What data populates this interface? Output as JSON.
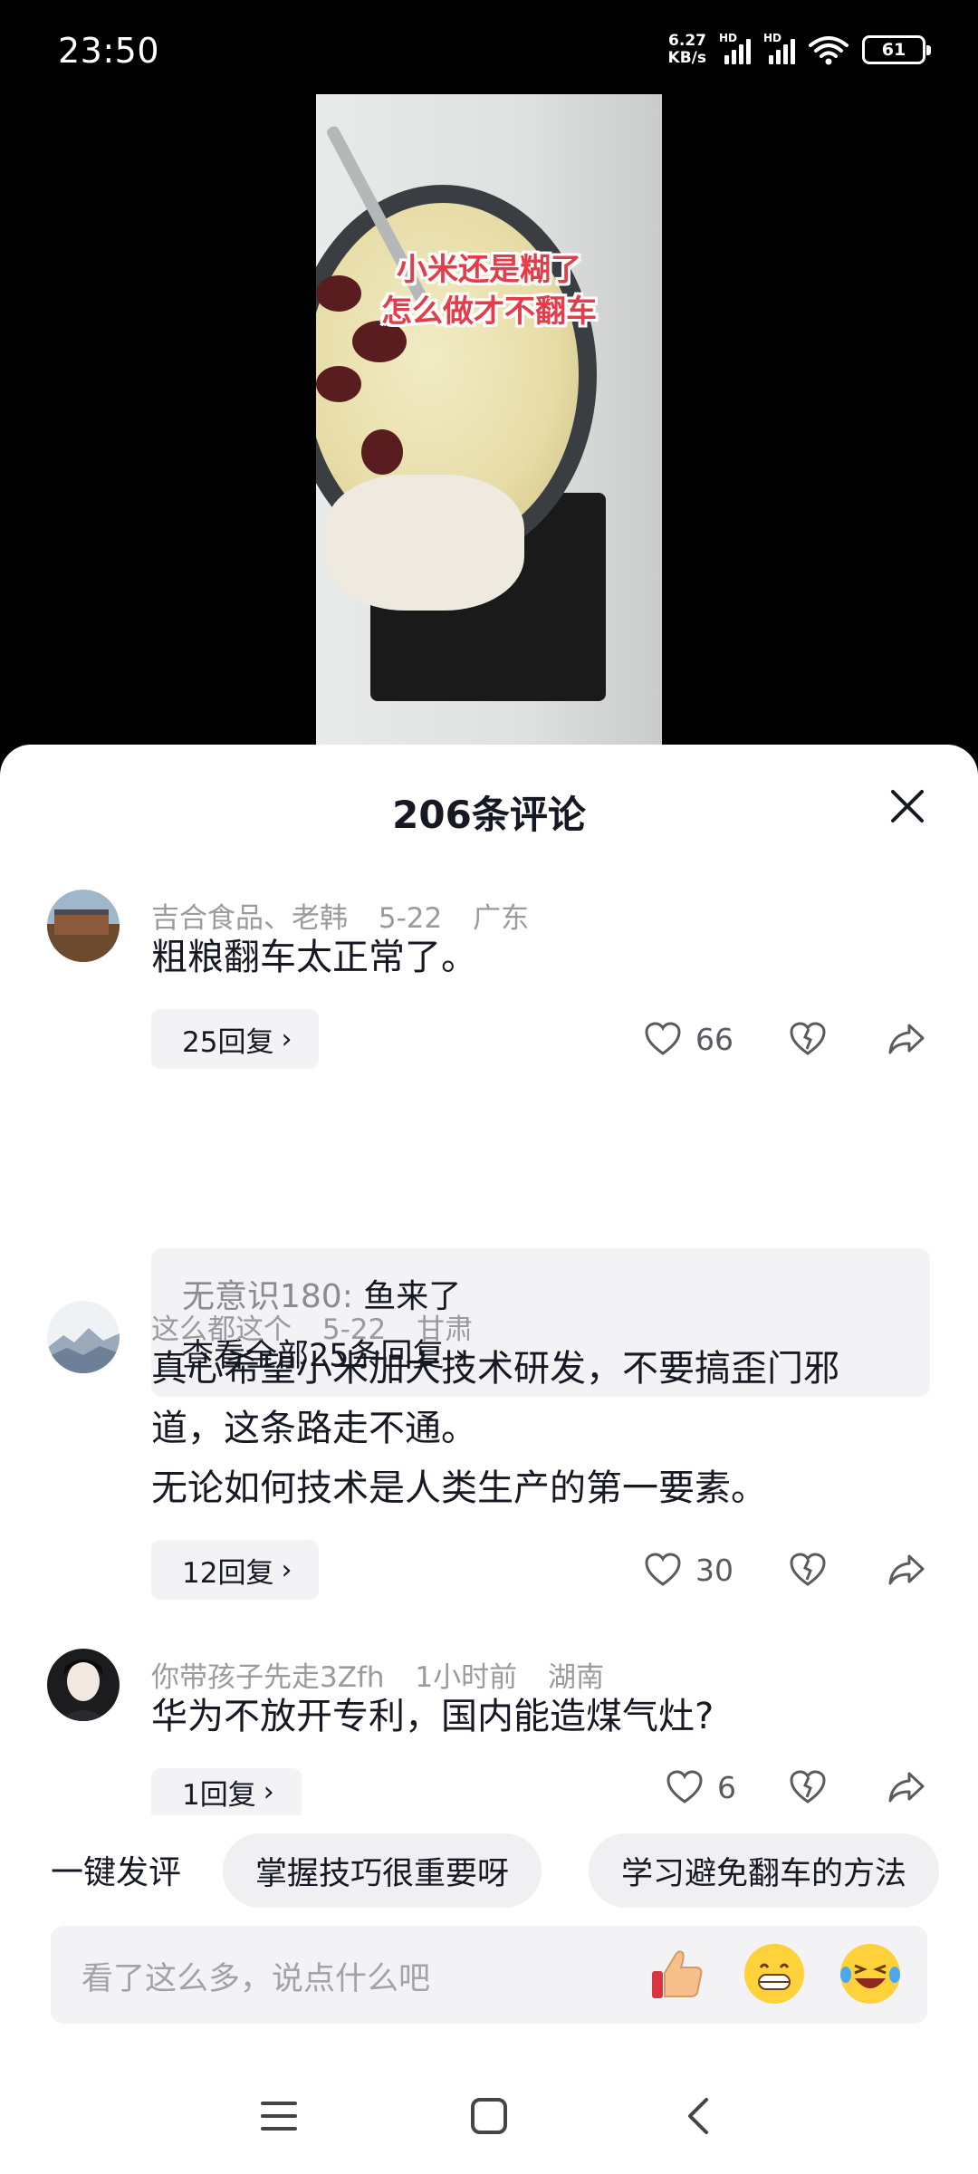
{
  "status_bar": {
    "time": "23:50",
    "net_speed_value": "6.27",
    "net_speed_unit": "KB/s",
    "signal_label_1": "HD",
    "signal_label_2": "HD",
    "battery": "61"
  },
  "video": {
    "caption_line1": "小米还是糊了",
    "caption_line2": "怎么做才不翻车"
  },
  "comments_panel": {
    "title": "206条评论",
    "comments": [
      {
        "author": "吉合食品、老韩",
        "date": "5-22",
        "location": "广东",
        "text": "粗粮翻车太正常了。",
        "replies_label": "25回复",
        "likes": "66",
        "sub_reply": {
          "author": "无意识180:",
          "text": "鱼来了",
          "view_all": "查看全部25条回复"
        }
      },
      {
        "author": "这么都这个",
        "date": "5-22",
        "location": "甘肃",
        "text_lines": [
          "真心希望小米加大技术研发，不要搞歪门邪",
          "道，这条路走不通。",
          "无论如何技术是人类生产的第一要素。"
        ],
        "replies_label": "12回复",
        "likes": "30"
      },
      {
        "author": "你带孩子先走3Zfh",
        "date": "1小时前",
        "location": "湖南",
        "text": "华为不放开专利，国内能造煤气灶?",
        "replies_label": "1回复",
        "likes": "6"
      }
    ]
  },
  "suggestions": {
    "lead": "一键发评",
    "chips": [
      "掌握技巧很重要呀",
      "学习避免翻车的方法"
    ]
  },
  "input": {
    "placeholder": "看了这么多，说点什么吧",
    "emojis": [
      "thumbs-up-icon",
      "grin-icon",
      "laugh-tears-icon"
    ]
  },
  "nav": {
    "icons": [
      "menu-icon",
      "home-square-icon",
      "back-icon"
    ]
  },
  "colors": {
    "caption_red": "#e63b48",
    "sheet_bg": "#ffffff",
    "pill_bg": "#f3f3f5",
    "meta_gray": "#9a9a9f"
  }
}
